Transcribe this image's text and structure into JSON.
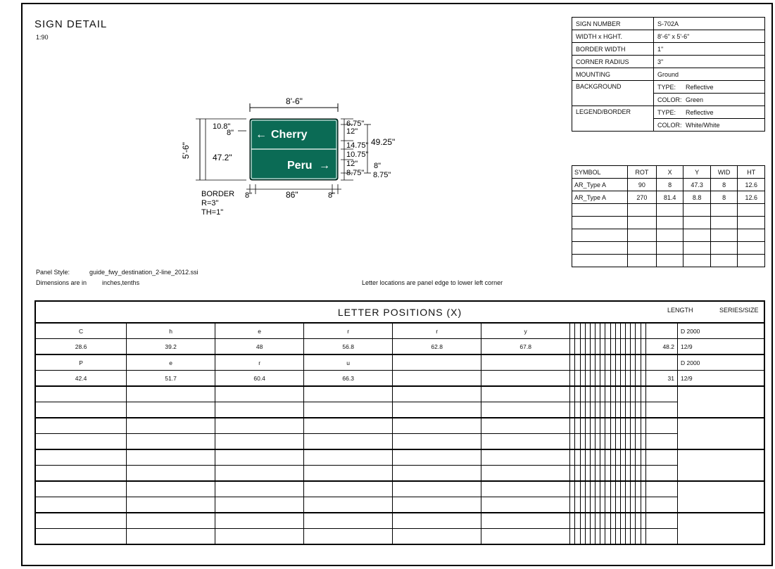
{
  "header": {
    "title": "SIGN DETAIL",
    "scale": "1:90",
    "panel_style_label": "Panel Style:",
    "panel_style_value": "guide_fwy_destination_2-line_2012.ssi",
    "dimensions_label": "Dimensions are in",
    "dimensions_value": "inches,tenths",
    "letter_locations_note": "Letter locations are panel edge to lower left corner"
  },
  "info_table": {
    "sign_number_label": "SIGN NUMBER",
    "sign_number": "S-702A",
    "width_height_label": "WIDTH x HGHT.",
    "width_height": "8'-6\" x 5'-6\"",
    "border_width_label": "BORDER WIDTH",
    "border_width": "1\"",
    "corner_radius_label": "CORNER RADIUS",
    "corner_radius": "3\"",
    "mounting_label": "MOUNTING",
    "mounting": "Ground",
    "background_label": "BACKGROUND",
    "background_type_label": "TYPE:",
    "background_type": "Reflective",
    "background_color_label": "COLOR:",
    "background_color": "Green",
    "legend_border_label": "LEGEND/BORDER",
    "legend_type_label": "TYPE:",
    "legend_type": "Reflective",
    "legend_color_label": "COLOR:",
    "legend_color": "White/White"
  },
  "symbol_table": {
    "headers": [
      "SYMBOL",
      "ROT",
      "X",
      "Y",
      "WID",
      "HT"
    ],
    "rows": [
      [
        "AR_Type A",
        "90",
        "8",
        "47.3",
        "8",
        "12.6"
      ],
      [
        "AR_Type A",
        "270",
        "81.4",
        "8.8",
        "8",
        "12.6"
      ]
    ]
  },
  "sign": {
    "line1_text": "Cherry",
    "line2_text": "Peru",
    "left_arrow": "←",
    "right_arrow": "→",
    "dim_width_top": "8'-6\"",
    "dim_height_left": "5'-6\"",
    "dim_top_margin": "10.8\"",
    "dim_top_border": "8\"",
    "dim_inner_height": "47.2\"",
    "dim_right_1": "6.75\"",
    "dim_right_2": "12\"",
    "dim_right_3": "14.75\"",
    "dim_right_4": "10.75\"",
    "dim_right_5": "12\"",
    "dim_right_6": "8.75\"",
    "dim_right_total": "49.25\"",
    "dim_right_7": "8\"",
    "dim_right_8": "8.75\"",
    "dim_bottom_left": "8\"",
    "dim_bottom_center": "86\"",
    "dim_bottom_right": "8\"",
    "border_label": "BORDER",
    "border_radius": "R=3\"",
    "border_thickness": "TH=1\"",
    "colors": {
      "panel": "#0b6b55",
      "text": "#ffffff"
    }
  },
  "letter_positions": {
    "title": "LETTER POSITIONS (X)",
    "length_label": "LENGTH",
    "series_size_label": "SERIES/SIZE",
    "rows": [
      {
        "letters": [
          "C",
          "h",
          "e",
          "r",
          "r",
          "y"
        ],
        "positions": [
          "28.6",
          "39.2",
          "48",
          "56.8",
          "62.8",
          "67.8"
        ],
        "length": "48.2",
        "series": "D 2000",
        "size": "12/9"
      },
      {
        "letters": [
          "P",
          "e",
          "r",
          "u"
        ],
        "positions": [
          "42.4",
          "51.7",
          "60.4",
          "66.3"
        ],
        "length": "31",
        "series": "D 2000",
        "size": "12/9"
      }
    ]
  }
}
